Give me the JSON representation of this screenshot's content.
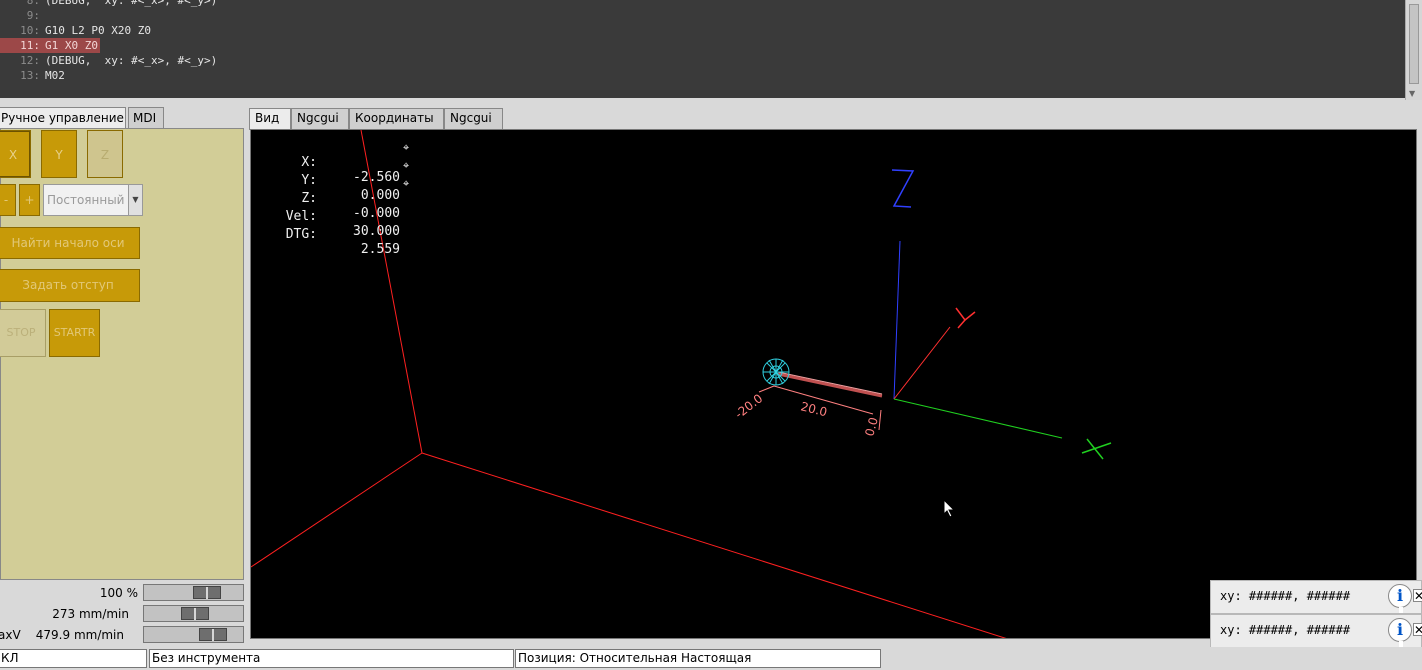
{
  "code": {
    "lines": [
      {
        "num": "8:",
        "text": "(DEBUG,  xy: #<_x>, #<_y>)"
      },
      {
        "num": "9:",
        "text": ""
      },
      {
        "num": "10:",
        "text": "G10 L2 P0 X20 Z0"
      },
      {
        "num": "11:",
        "text": "G1 X0 Z0"
      },
      {
        "num": "12:",
        "text": "(DEBUG,  xy: #<_x>, #<_y>)"
      },
      {
        "num": "13:",
        "text": "M02"
      }
    ],
    "highlighted_line": "11:"
  },
  "left_tabs": [
    "Ручное управление",
    "MDI"
  ],
  "manual": {
    "axes": [
      "X",
      "Y",
      "Z"
    ],
    "jog_minus": "-",
    "jog_plus": "+",
    "jog_mode": "Постоянный",
    "home_button": "Найти начало оси",
    "touch_off_button": "Задать отступ",
    "stop_button": "STOP",
    "start_button": "STARTR"
  },
  "feed": {
    "override": "100 %",
    "jog_speed": "273 mm/min",
    "max_velocity_label": "axV",
    "max_velocity": "479.9 mm/min",
    "override_level": 0.69,
    "jog_level": 0.52,
    "maxv_level": 0.77
  },
  "right_tabs": [
    "Вид",
    "Ngcgui",
    "Координаты",
    "Ngcgui"
  ],
  "dro": {
    "x_label": "X:",
    "x_value": "-2.560",
    "y_label": "Y:",
    "y_value": "0.000",
    "z_label": "Z:",
    "z_value": "-0.000",
    "vel_label": "Vel:",
    "vel_value": "30.000",
    "dtg_label": "DTG:",
    "dtg_value": "2.559",
    "homed_mark": "⌖"
  },
  "preview": {
    "axis_z": "Z",
    "axis_y": "Y",
    "axis_x": "X",
    "dim_a": "-20.0",
    "dim_b": "20.0",
    "dim_c": "0.0",
    "colors": {
      "limits": "#ff2020",
      "z_axis": "#3040ff",
      "y_axis": "#ff3030",
      "x_axis": "#20d020",
      "tool": "#30d0e0",
      "dimension": "#ff8080",
      "path": "#c05050"
    }
  },
  "status": {
    "state": "КЛ",
    "tool": "Без инструмента",
    "position": "Позиция: Относительная Настоящая"
  },
  "popups": [
    {
      "text": "xy: ######, ######"
    },
    {
      "text": "xy: ######, ######"
    }
  ],
  "popup_close": "✕"
}
